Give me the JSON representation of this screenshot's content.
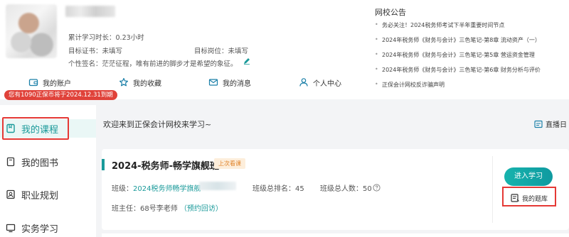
{
  "profile": {
    "study_time": "累计学习时长：0.23小时",
    "target_cert": "目标证书：未填写",
    "target_position": "目标岗位：未填写",
    "signature": "个性签名：茫茫征程，唯有前进的脚步才是希望的象征。",
    "coin_badge": "您有1090正保币将于2024.12.31到期"
  },
  "nav": [
    {
      "label": "我的账户",
      "icon": "wallet-icon"
    },
    {
      "label": "我的收藏",
      "icon": "star-icon"
    },
    {
      "label": "我的消息",
      "icon": "mail-icon"
    },
    {
      "label": "个人中心",
      "icon": "user-icon"
    }
  ],
  "notice": {
    "title": "网校公告",
    "items": [
      "务必关注！2024税务师考试下半年重要时间节点",
      "2024年税务师《财务与会计》三色笔记-第8章 流动资产（一）",
      "2024年税务师《财务与会计》三色笔记-第5章 营运资金管理",
      "2024年税务师《财务与会计》三色笔记-第6章 财务分析与评价",
      "正保会计网校反诈骗声明"
    ]
  },
  "sidebar": {
    "items": [
      {
        "label": "我的课程",
        "icon": "course-icon"
      },
      {
        "label": "我的图书",
        "icon": "book-icon"
      },
      {
        "label": "职业规划",
        "icon": "career-icon"
      },
      {
        "label": "实务学习",
        "icon": "practice-icon"
      }
    ]
  },
  "main": {
    "welcome": "欢迎来到正保会计网校来学习~",
    "live_label": "直播日",
    "course": {
      "title": "2024-税务师-畅学旗舰班",
      "last_tag": "上次看课",
      "class_prefix": "班级：",
      "class_name": "2024税务师畅学旗舰",
      "rank": "班级总排名：45",
      "total": "班级总人数：50",
      "teacher": "班主任：68号李老师",
      "appointment": "（预约回访）",
      "enter_button": "进入学习",
      "bank_button": "我的题库"
    }
  },
  "colors": {
    "accent": "#1a9a9a",
    "highlight_box": "#e53935",
    "badge": "#e0423a"
  }
}
